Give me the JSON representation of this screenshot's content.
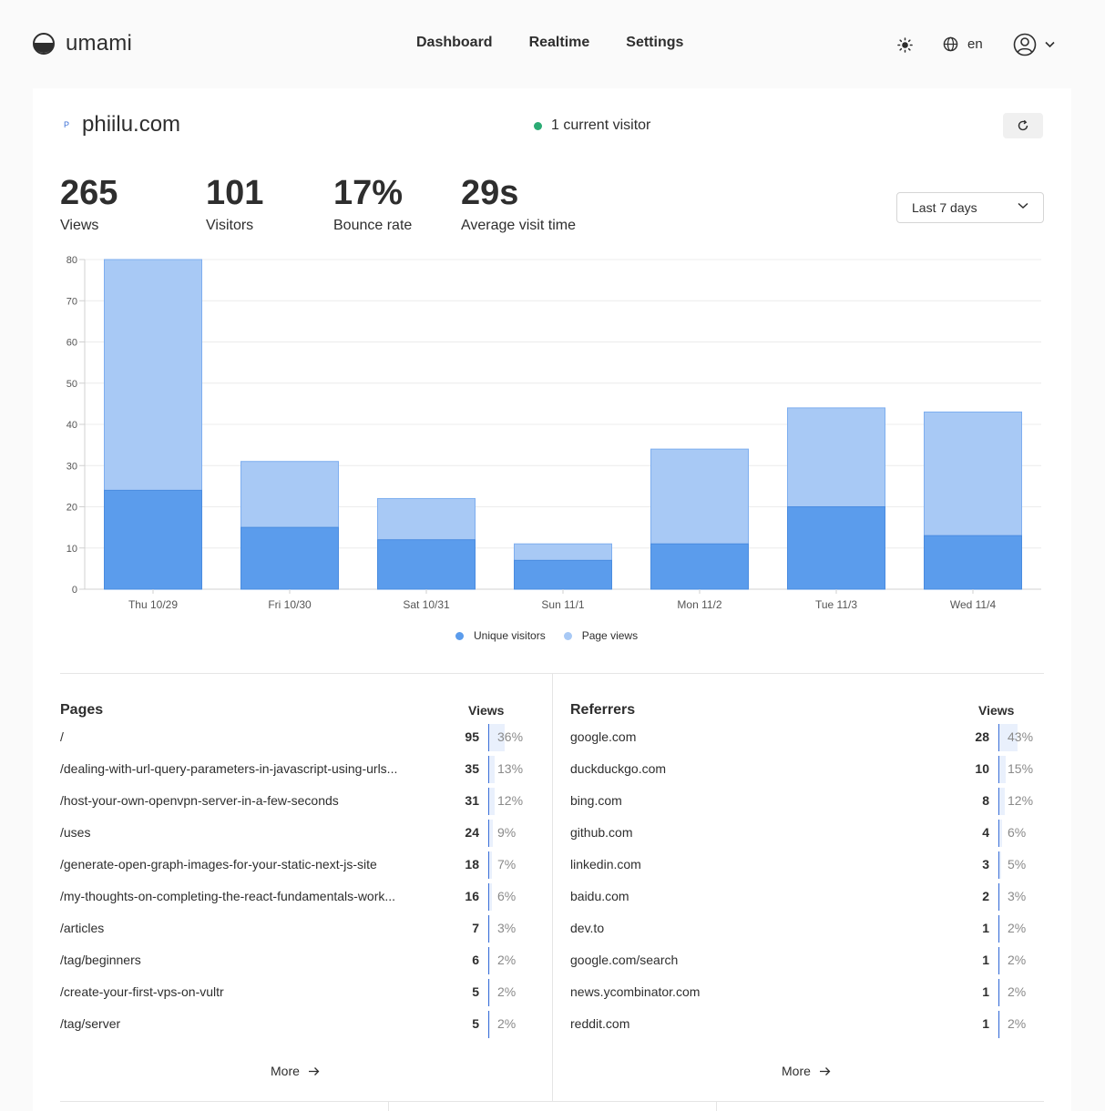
{
  "app": {
    "name": "umami",
    "nav": [
      "Dashboard",
      "Realtime",
      "Settings"
    ],
    "language": "en"
  },
  "site": {
    "favicon_letter": "P",
    "name": "phiilu.com",
    "current_visitors": "1 current visitor"
  },
  "metrics": [
    {
      "value": "265",
      "label": "Views"
    },
    {
      "value": "101",
      "label": "Visitors"
    },
    {
      "value": "17%",
      "label": "Bounce rate"
    },
    {
      "value": "29s",
      "label": "Average visit time"
    }
  ],
  "date_range": "Last 7 days",
  "colors": {
    "visitors": "#5b9cec",
    "views": "#a8c9f5",
    "status": "#2bab74"
  },
  "chart_data": {
    "type": "bar",
    "stacked": "overlapping",
    "categories": [
      "Thu 10/29",
      "Fri 10/30",
      "Sat 10/31",
      "Sun 11/1",
      "Mon 11/2",
      "Tue 11/3",
      "Wed 11/4"
    ],
    "series": [
      {
        "name": "Unique visitors",
        "values": [
          24,
          15,
          12,
          7,
          11,
          20,
          13
        ]
      },
      {
        "name": "Page views",
        "values": [
          80,
          31,
          22,
          11,
          34,
          44,
          43
        ]
      }
    ],
    "ylim": [
      0,
      80
    ],
    "yticks": [
      "0",
      "10",
      "20",
      "30",
      "40",
      "50",
      "60",
      "70",
      "80"
    ],
    "grid": true,
    "legend": "bottom-center"
  },
  "pages": {
    "title": "Pages",
    "column": "Views",
    "more": "More",
    "rows": [
      {
        "label": "/",
        "value": "95",
        "pct": "36%",
        "share": 36
      },
      {
        "label": "/dealing-with-url-query-parameters-in-javascript-using-urls...",
        "value": "35",
        "pct": "13%",
        "share": 13
      },
      {
        "label": "/host-your-own-openvpn-server-in-a-few-seconds",
        "value": "31",
        "pct": "12%",
        "share": 12
      },
      {
        "label": "/uses",
        "value": "24",
        "pct": "9%",
        "share": 9
      },
      {
        "label": "/generate-open-graph-images-for-your-static-next-js-site",
        "value": "18",
        "pct": "7%",
        "share": 7
      },
      {
        "label": "/my-thoughts-on-completing-the-react-fundamentals-work...",
        "value": "16",
        "pct": "6%",
        "share": 6
      },
      {
        "label": "/articles",
        "value": "7",
        "pct": "3%",
        "share": 3
      },
      {
        "label": "/tag/beginners",
        "value": "6",
        "pct": "2%",
        "share": 2
      },
      {
        "label": "/create-your-first-vps-on-vultr",
        "value": "5",
        "pct": "2%",
        "share": 2
      },
      {
        "label": "/tag/server",
        "value": "5",
        "pct": "2%",
        "share": 2
      }
    ]
  },
  "referrers": {
    "title": "Referrers",
    "column": "Views",
    "more": "More",
    "rows": [
      {
        "label": "google.com",
        "value": "28",
        "pct": "43%",
        "share": 43
      },
      {
        "label": "duckduckgo.com",
        "value": "10",
        "pct": "15%",
        "share": 15
      },
      {
        "label": "bing.com",
        "value": "8",
        "pct": "12%",
        "share": 12
      },
      {
        "label": "github.com",
        "value": "4",
        "pct": "6%",
        "share": 6
      },
      {
        "label": "linkedin.com",
        "value": "3",
        "pct": "5%",
        "share": 5
      },
      {
        "label": "baidu.com",
        "value": "2",
        "pct": "3%",
        "share": 3
      },
      {
        "label": "dev.to",
        "value": "1",
        "pct": "2%",
        "share": 2
      },
      {
        "label": "google.com/search",
        "value": "1",
        "pct": "2%",
        "share": 2
      },
      {
        "label": "news.ycombinator.com",
        "value": "1",
        "pct": "2%",
        "share": 2
      },
      {
        "label": "reddit.com",
        "value": "1",
        "pct": "2%",
        "share": 2
      }
    ]
  }
}
